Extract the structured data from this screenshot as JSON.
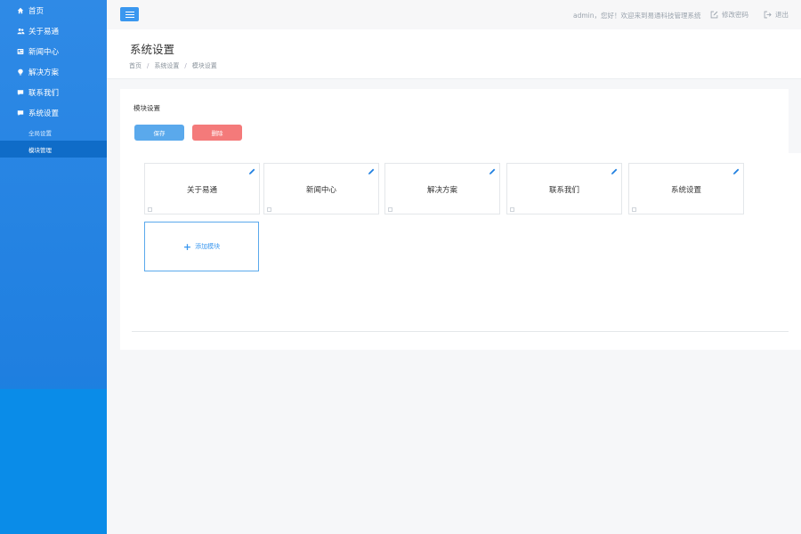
{
  "sidebar": {
    "items": [
      {
        "label": "首页",
        "icon": "home-icon"
      },
      {
        "label": "关于易通",
        "icon": "users-icon"
      },
      {
        "label": "新闻中心",
        "icon": "news-icon"
      },
      {
        "label": "解决方案",
        "icon": "lightbulb-icon"
      },
      {
        "label": "联系我们",
        "icon": "chat-icon"
      },
      {
        "label": "系统设置",
        "icon": "chat-icon"
      }
    ],
    "subitems": [
      {
        "label": "全局设置",
        "active": false
      },
      {
        "label": "模块管理",
        "active": true
      }
    ]
  },
  "header": {
    "welcome": "admin，您好！欢迎来到易通科技管理系统",
    "change_password": "修改密码",
    "logout": "退出"
  },
  "page": {
    "title": "系统设置",
    "breadcrumb": [
      "首页",
      "系统设置",
      "模块设置"
    ]
  },
  "panel": {
    "title": "模块设置",
    "save_label": "保存",
    "delete_label": "删除",
    "modules": [
      "关于易通",
      "新闻中心",
      "解决方案",
      "联系我们",
      "系统设置"
    ],
    "add_label": "添加模块"
  },
  "colors": {
    "accent": "#3a97ef",
    "sidebar": "#1f7fe0",
    "danger": "#f47a7a"
  }
}
